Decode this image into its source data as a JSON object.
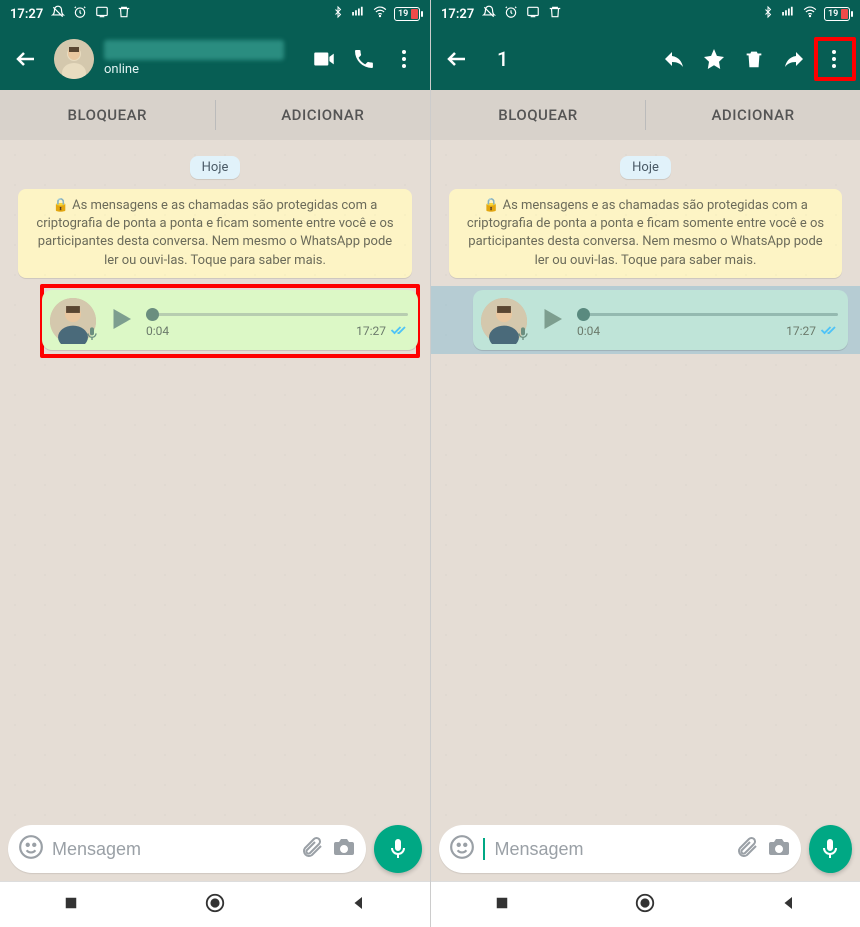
{
  "status": {
    "time": "17:27",
    "battery": "19"
  },
  "left": {
    "header": {
      "status": "online"
    },
    "actionbar": {
      "block": "BLOQUEAR",
      "add": "ADICIONAR"
    },
    "date_chip": "Hoje",
    "encryption_notice": "🔒 As mensagens e as chamadas são protegidas com a criptografia de ponta a ponta e ficam somente entre você e os participantes desta conversa. Nem mesmo o WhatsApp pode ler ou ouvi-las. Toque para saber mais.",
    "voice": {
      "duration": "0:04",
      "time": "17:27"
    },
    "input": {
      "placeholder": "Mensagem"
    }
  },
  "right": {
    "header": {
      "count": "1"
    },
    "actionbar": {
      "block": "BLOQUEAR",
      "add": "ADICIONAR"
    },
    "date_chip": "Hoje",
    "encryption_notice": "🔒 As mensagens e as chamadas são protegidas com a criptografia de ponta a ponta e ficam somente entre você e os participantes desta conversa. Nem mesmo o WhatsApp pode ler ou ouvi-las. Toque para saber mais.",
    "voice": {
      "duration": "0:04",
      "time": "17:27"
    },
    "input": {
      "placeholder": "Mensagem"
    }
  }
}
